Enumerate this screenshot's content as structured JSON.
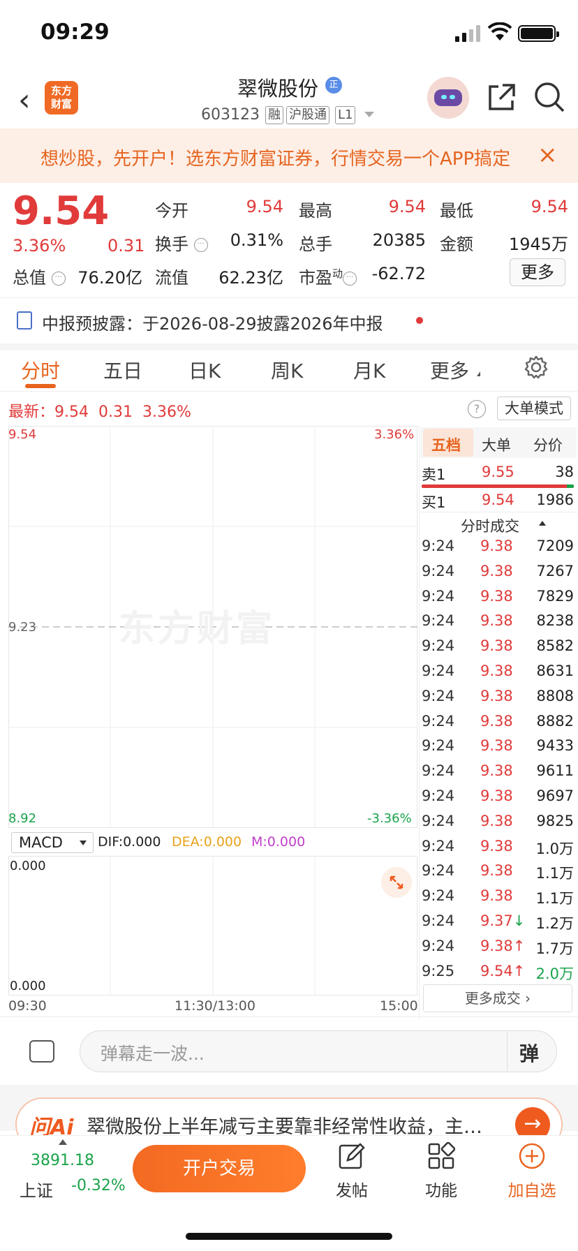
{
  "status": {
    "time": "09:29"
  },
  "header": {
    "logo": [
      "东方",
      "财富"
    ],
    "title": "翠微股份",
    "title_badge": "正",
    "code": "603123",
    "tags": [
      "融",
      "沪股通",
      "L1"
    ]
  },
  "banner": {
    "text": "想炒股，先开户！选东方财富证券，行情交易一个APP搞定",
    "close": "×"
  },
  "quote": {
    "price": "9.54",
    "pct": "3.36%",
    "change": "0.31",
    "fields": [
      {
        "label": "今开",
        "value": "9.54",
        "color": "red"
      },
      {
        "label": "最高",
        "value": "9.54",
        "color": "red"
      },
      {
        "label": "最低",
        "value": "9.54",
        "color": "red"
      },
      {
        "label": "换手",
        "value": "0.31%",
        "color": "dark"
      },
      {
        "label": "总手",
        "value": "20385",
        "color": "dark"
      },
      {
        "label": "金额",
        "value": "1945万",
        "color": "dark"
      },
      {
        "label": "总值",
        "value": "76.20亿",
        "color": "dark"
      },
      {
        "label": "流值",
        "value": "62.23亿",
        "color": "dark"
      },
      {
        "label": "市盈",
        "label_sup": "动",
        "value": "-62.72",
        "color": "dark"
      }
    ],
    "more": "更多"
  },
  "report": {
    "text": "中报预披露：于2026-08-29披露2026年中报"
  },
  "chart_tabs": [
    "分时",
    "五日",
    "日K",
    "周K",
    "月K",
    "更多"
  ],
  "latest": {
    "label": "最新：",
    "price": "9.54",
    "change": "0.31",
    "pct": "3.36%"
  },
  "big_order_mode": "大单模式",
  "help": "?",
  "watermark": "东方财富",
  "chart_data": {
    "type": "line",
    "title": "",
    "y_left_labels": [
      "9.54",
      "9.23",
      "8.92"
    ],
    "y_right_labels": [
      "3.36%",
      "-3.36%"
    ],
    "x_labels": [
      "09:30",
      "11:30/13:00",
      "15:00"
    ],
    "ylim": [
      8.92,
      9.54
    ],
    "baseline": 9.23,
    "series": []
  },
  "macd": {
    "selector": "MACD",
    "dif": "DIF:0.000",
    "dea": "DEA:0.000",
    "m": "M:0.000",
    "top_label": "0.000",
    "bottom_label": "0.000"
  },
  "orderbook": {
    "tabs": [
      "五档",
      "大单",
      "分价"
    ],
    "sell": {
      "label": "卖1",
      "price": "9.55",
      "vol": "38"
    },
    "buy": {
      "label": "买1",
      "price": "9.54",
      "vol": "1986"
    },
    "trades_title": "分时成交",
    "trades": [
      {
        "time": "9:24",
        "price": "9.38",
        "vol": "7209"
      },
      {
        "time": "9:24",
        "price": "9.38",
        "vol": "7267"
      },
      {
        "time": "9:24",
        "price": "9.38",
        "vol": "7829"
      },
      {
        "time": "9:24",
        "price": "9.38",
        "vol": "8238"
      },
      {
        "time": "9:24",
        "price": "9.38",
        "vol": "8582"
      },
      {
        "time": "9:24",
        "price": "9.38",
        "vol": "8631"
      },
      {
        "time": "9:24",
        "price": "9.38",
        "vol": "8808"
      },
      {
        "time": "9:24",
        "price": "9.38",
        "vol": "8882"
      },
      {
        "time": "9:24",
        "price": "9.38",
        "vol": "9433"
      },
      {
        "time": "9:24",
        "price": "9.38",
        "vol": "9611"
      },
      {
        "time": "9:24",
        "price": "9.38",
        "vol": "9697"
      },
      {
        "time": "9:24",
        "price": "9.38",
        "vol": "9825"
      },
      {
        "time": "9:24",
        "price": "9.38",
        "vol": "1.0万"
      },
      {
        "time": "9:24",
        "price": "9.38",
        "vol": "1.1万"
      },
      {
        "time": "9:24",
        "price": "9.38",
        "vol": "1.1万"
      },
      {
        "time": "9:24",
        "price": "9.37↓",
        "vol": "1.2万"
      },
      {
        "time": "9:24",
        "price": "9.38↑",
        "vol": "1.7万"
      },
      {
        "time": "9:25",
        "price": "9.54↑",
        "vol": "2.0万",
        "vol_color": "green"
      }
    ],
    "more": "更多成交"
  },
  "danmu": {
    "placeholder": "弹幕走一波...",
    "button": "弹"
  },
  "ai": {
    "logo": "问Ai",
    "text": "翠微股份上半年减亏主要靠非经常性收益，主…"
  },
  "bottom": {
    "index_value": "3891.18",
    "index_name": "上证",
    "index_pct": "-0.32%",
    "open_button": "开户交易",
    "nav": [
      "发帖",
      "功能",
      "加自选"
    ]
  },
  "colors": {
    "red": "#e03a3a",
    "green": "#1aa34a",
    "accent": "#e8641e"
  }
}
